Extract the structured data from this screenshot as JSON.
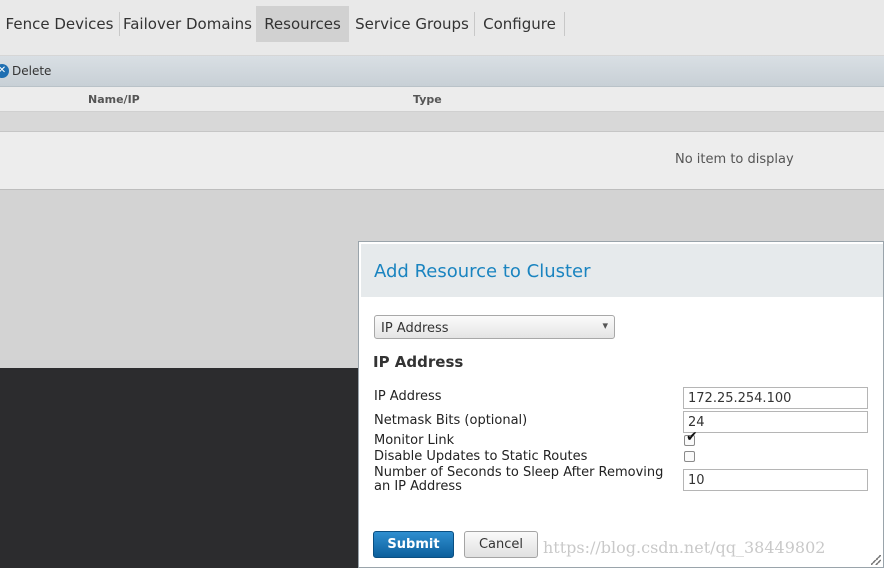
{
  "tabs": [
    {
      "label": "Fence Devices"
    },
    {
      "label": "Failover Domains"
    },
    {
      "label": "Resources",
      "active": true
    },
    {
      "label": "Service Groups"
    },
    {
      "label": "Configure"
    }
  ],
  "toolbar": {
    "delete_label": "Delete",
    "delete_icon": "close-circle-icon"
  },
  "table": {
    "columns": [
      "Name/IP",
      "Type"
    ],
    "empty_message": "No item to display"
  },
  "dialog": {
    "title": "Add Resource to Cluster",
    "resource_type": "IP Address",
    "section_title": "IP Address",
    "fields": [
      {
        "label": "IP Address",
        "value": "172.25.254.100"
      },
      {
        "label": "Netmask Bits (optional)",
        "value": "24"
      },
      {
        "label": "Monitor Link",
        "checked": true
      },
      {
        "label": "Disable Updates to Static Routes",
        "checked": false
      },
      {
        "label": "Number of Seconds to Sleep After Removing an IP Address",
        "value": "10"
      }
    ],
    "submit_label": "Submit",
    "cancel_label": "Cancel"
  },
  "watermark": "https://blog.csdn.net/qq_38449802",
  "colors": {
    "accent": "#1a84c0",
    "submit": "#1a73b8"
  }
}
